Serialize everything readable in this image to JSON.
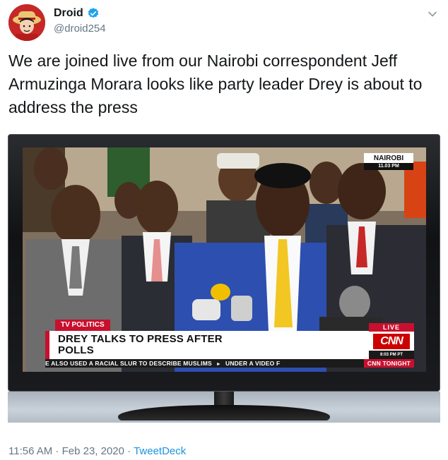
{
  "tweet": {
    "display_name": "Droid",
    "handle": "@droid254",
    "text": "We are joined live from our Nairobi correspondent  Jeff Armuzinga Morara looks like party leader Drey is about to address the press",
    "timestamp": "11:56 AM · Feb 23, 2020 · ",
    "source": "TweetDeck",
    "verified": true
  },
  "icons": {
    "avatar": "anime-avatar",
    "verified": "verified-badge-icon",
    "menu": "chevron-down-icon"
  },
  "broadcast": {
    "city": "NAIROBI",
    "city_time": "11.03 PM",
    "tag": "TV POLITICS",
    "headline_line1": "DREY TALKS TO PRESS AFTER",
    "headline_line2": "POLLS",
    "live": "LIVE",
    "network": "CNN",
    "live_time": "8:03 PM PT",
    "ticker_1": "E ALSO USED A RACIAL SLUR TO DESCRIBE MUSLIMS",
    "ticker_2": "UNDER A VIDEO F",
    "ticker_brand": "CNN TONIGHT"
  },
  "colors": {
    "accent": "#1b95e0",
    "verified": "#1da1f2",
    "cnn_red": "#c8102e"
  }
}
